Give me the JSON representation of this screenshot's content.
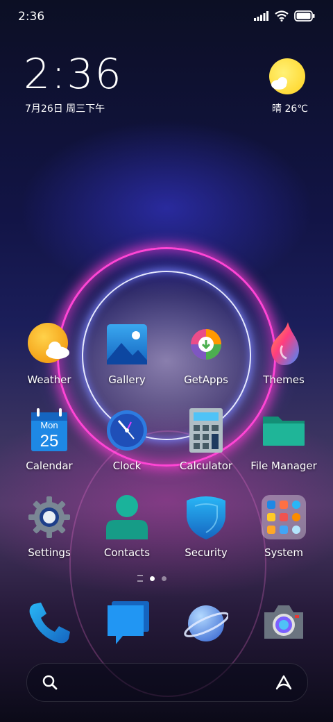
{
  "status_bar": {
    "time": "2:36",
    "icons": [
      "signal-icon",
      "wifi-icon",
      "battery-icon"
    ]
  },
  "clock_widget": {
    "time": "2:36",
    "date": "7月26日 周三下午"
  },
  "weather_widget": {
    "text": "晴 26℃",
    "icon": "sun-cloud-icon"
  },
  "apps": [
    {
      "label": "Weather",
      "icon": "weather-app-icon"
    },
    {
      "label": "Gallery",
      "icon": "gallery-app-icon"
    },
    {
      "label": "GetApps",
      "icon": "getapps-app-icon"
    },
    {
      "label": "Themes",
      "icon": "themes-app-icon"
    },
    {
      "label": "Calendar",
      "icon": "calendar-app-icon",
      "badge_day": "Mon",
      "badge_date": "25"
    },
    {
      "label": "Clock",
      "icon": "clock-app-icon"
    },
    {
      "label": "Calculator",
      "icon": "calculator-app-icon"
    },
    {
      "label": "File Manager",
      "icon": "file-manager-app-icon"
    },
    {
      "label": "Settings",
      "icon": "settings-app-icon"
    },
    {
      "label": "Contacts",
      "icon": "contacts-app-icon"
    },
    {
      "label": "Security",
      "icon": "security-app-icon"
    },
    {
      "label": "System",
      "icon": "system-folder-icon"
    }
  ],
  "page_indicator": {
    "pages": 2,
    "current": 1
  },
  "dock": [
    {
      "icon": "phone-app-icon"
    },
    {
      "icon": "messages-app-icon"
    },
    {
      "icon": "browser-app-icon"
    },
    {
      "icon": "camera-app-icon"
    }
  ],
  "search_bar": {
    "left_icon": "search-icon",
    "right_icon": "assistant-icon"
  },
  "colors": {
    "accent_pink": "#ff45d5",
    "accent_blue": "#1e90ff"
  }
}
